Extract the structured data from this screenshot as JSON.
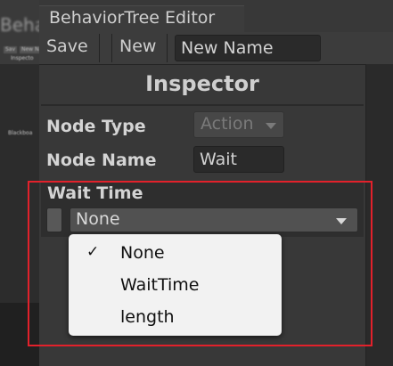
{
  "background_window": {
    "title": "Behav",
    "mini_buttons": [
      "Sav",
      "New Na"
    ],
    "mini_labels": [
      "Inspecto",
      "Blackboa"
    ]
  },
  "window": {
    "title": "BehaviorTree Editor"
  },
  "toolbar": {
    "save_label": "Save",
    "new_label": "New",
    "name_value": "New Name"
  },
  "inspector": {
    "title": "Inspector",
    "node_type_label": "Node Type",
    "node_type_value": "Action",
    "node_name_label": "Node Name",
    "node_name_value": "Wait"
  },
  "wait_time": {
    "label": "Wait Time",
    "selected": "None",
    "options": [
      {
        "label": "None",
        "checked": true
      },
      {
        "label": "WaitTime",
        "checked": false
      },
      {
        "label": "length",
        "checked": false
      }
    ],
    "check_glyph": "✓"
  },
  "colors": {
    "highlight": "#e2212b",
    "window_bg": "#383838",
    "popup_bg": "#f2f2f2"
  }
}
